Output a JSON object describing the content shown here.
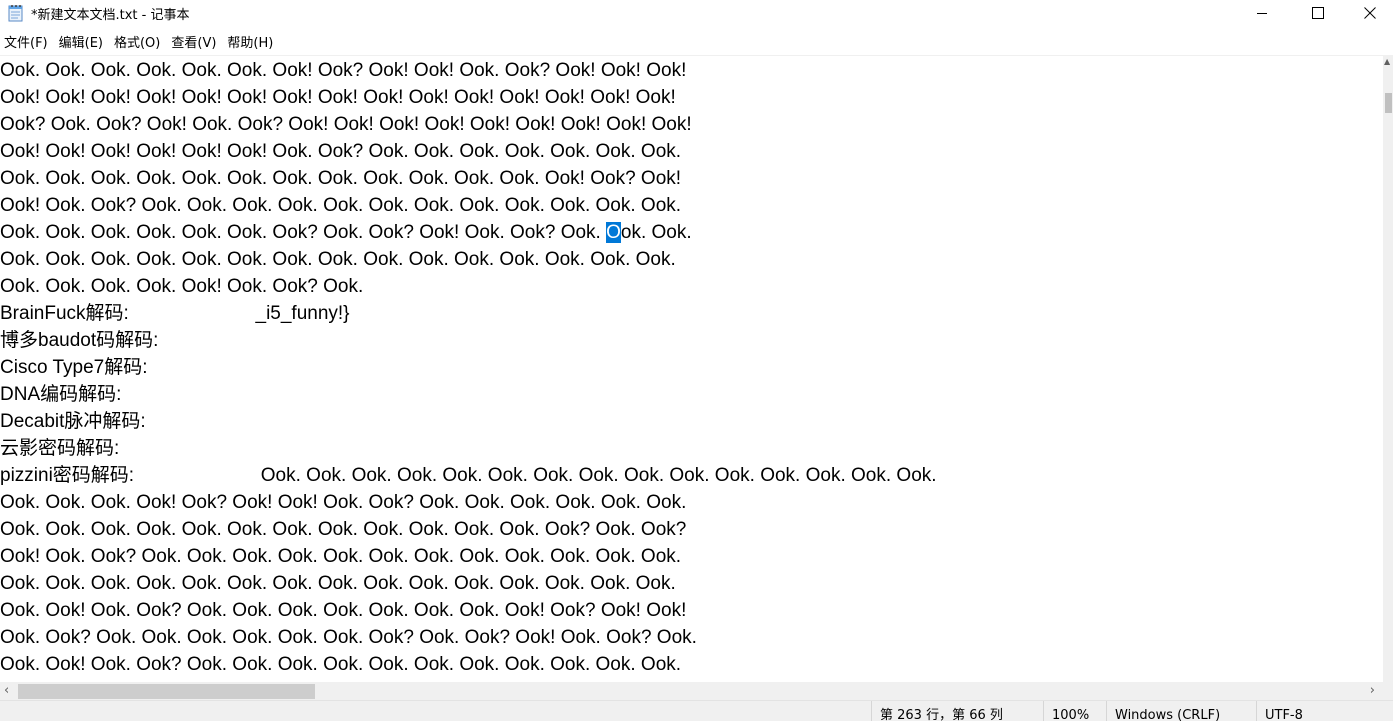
{
  "window": {
    "title": "*新建文本文档.txt - 记事本",
    "icon": "notepad-icon",
    "controls": {
      "minimize": "minimize-icon",
      "maximize": "maximize-icon",
      "close": "close-icon"
    }
  },
  "menu": [
    {
      "label": "文件(F)"
    },
    {
      "label": "编辑(E)"
    },
    {
      "label": "格式(O)"
    },
    {
      "label": "查看(V)"
    },
    {
      "label": "帮助(H)"
    }
  ],
  "editor": {
    "lines": [
      "Ook. Ook. Ook. Ook. Ook. Ook. Ook! Ook? Ook! Ook! Ook. Ook? Ook! Ook! Ook!",
      "Ook! Ook! Ook! Ook! Ook! Ook! Ook! Ook! Ook! Ook! Ook! Ook! Ook! Ook! Ook!",
      "Ook? Ook. Ook? Ook! Ook. Ook? Ook! Ook! Ook! Ook! Ook! Ook! Ook! Ook! Ook!",
      "Ook! Ook! Ook! Ook! Ook! Ook! Ook. Ook? Ook. Ook. Ook. Ook. Ook. Ook. Ook.",
      "Ook. Ook. Ook. Ook. Ook. Ook. Ook. Ook. Ook. Ook. Ook. Ook. Ook! Ook? Ook!",
      "Ook! Ook. Ook? Ook. Ook. Ook. Ook. Ook. Ook. Ook. Ook. Ook. Ook. Ook. Ook.",
      "Ook. Ook. Ook. Ook. Ook. Ook. Ook? Ook. Ook? Ook! Ook. Ook? Ook. Ook. Ook.",
      "Ook. Ook. Ook. Ook. Ook. Ook. Ook. Ook. Ook. Ook. Ook. Ook. Ook. Ook. Ook.",
      "Ook. Ook. Ook. Ook. Ook! Ook. Ook? Ook.",
      "BrainFuck解码:                        _i5_funny!}",
      "博多baudot码解码:",
      "Cisco Type7解码:",
      "DNA编码解码:",
      "Decabit脉冲解码:",
      "云影密码解码:",
      "pizzini密码解码:                        Ook. Ook. Ook. Ook. Ook. Ook. Ook. Ook. Ook. Ook. Ook. Ook. Ook. Ook. Ook.",
      "Ook. Ook. Ook. Ook! Ook? Ook! Ook! Ook. Ook? Ook. Ook. Ook. Ook. Ook. Ook.",
      "Ook. Ook. Ook. Ook. Ook. Ook. Ook. Ook. Ook. Ook. Ook. Ook. Ook? Ook. Ook?",
      "Ook! Ook. Ook? Ook. Ook. Ook. Ook. Ook. Ook. Ook. Ook. Ook. Ook. Ook. Ook.",
      "Ook. Ook. Ook. Ook. Ook. Ook. Ook. Ook. Ook. Ook. Ook. Ook. Ook. Ook. Ook.",
      "Ook. Ook! Ook. Ook? Ook. Ook. Ook. Ook. Ook. Ook. Ook. Ook! Ook? Ook! Ook!",
      "Ook. Ook? Ook. Ook. Ook. Ook. Ook. Ook. Ook? Ook. Ook? Ook! Ook. Ook? Ook.",
      "Ook. Ook! Ook. Ook? Ook. Ook. Ook. Ook. Ook. Ook. Ook. Ook. Ook. Ook. Ook."
    ],
    "selection": {
      "line_index": 6,
      "before": "Ook. Ook. Ook. Ook. Ook. Ook. Ook? Ook. Ook? Ook! Ook. Ook? Ook. ",
      "selected": "O",
      "after": "ok. Ook."
    },
    "selection_color": "#0078d7"
  },
  "statusbar": {
    "position": "第 263 行，第 66 列",
    "zoom": "100%",
    "line_ending": "Windows (CRLF)",
    "encoding": "UTF-8"
  }
}
